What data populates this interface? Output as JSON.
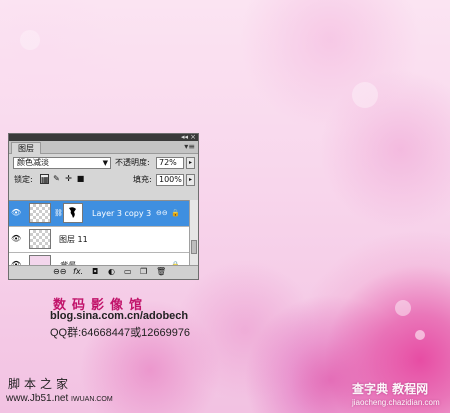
{
  "panel": {
    "tab_label": "图层",
    "blend_mode": "颜色减淡",
    "opacity_label": "不透明度:",
    "opacity_value": "72%",
    "lock_label": "锁定:",
    "fill_label": "填充:",
    "fill_value": "100%",
    "layers": [
      {
        "name": "Layer 3 copy 3",
        "selected": true
      },
      {
        "name": "图层 11",
        "selected": false
      },
      {
        "name": "背景",
        "selected": false
      }
    ],
    "footer_fx": "fx."
  },
  "overlay": {
    "studio": "数码影像馆",
    "blog": "blog.sina.com.cn/adobech",
    "qq": "QQ群:64668447或12669976",
    "site_left_title": "脚本之家",
    "site_left_url": "www.Jb51.net",
    "site_left_small": "IWUAN.COM",
    "site_right_title": "查字典 教程网",
    "site_right_url": "jiaocheng.chazidian.com"
  }
}
